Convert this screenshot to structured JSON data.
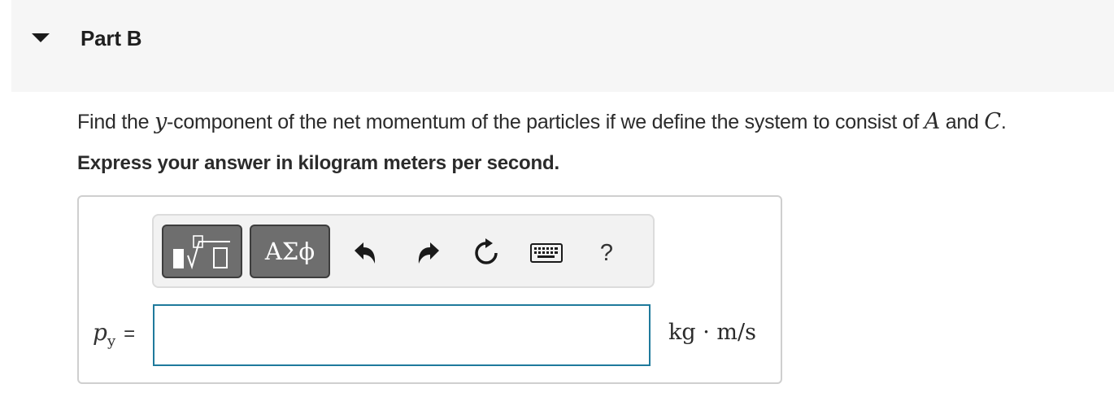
{
  "part": {
    "title": "Part B",
    "toggle_icon": "caret-down-icon"
  },
  "question": {
    "text_before": "Find the ",
    "var_y": "y",
    "text_middle": "-component of the net momentum of the particles if we define the system to consist of ",
    "var_a": "A",
    "text_and": " and ",
    "var_c": "C",
    "text_end": "."
  },
  "instruction": "Express your answer in kilogram meters per second.",
  "toolbar": {
    "templates_icon": "templates-icon",
    "greek_label": "ΑΣϕ",
    "undo_icon": "undo-icon",
    "redo_icon": "redo-icon",
    "reset_icon": "reset-icon",
    "keyboard_icon": "keyboard-icon",
    "help_label": "?"
  },
  "answer": {
    "variable": "p",
    "subscript": "y",
    "equals": "=",
    "value": "",
    "units": "kg · m/s"
  },
  "colors": {
    "header_bg": "#f6f6f6",
    "input_border": "#1f7a9c",
    "button_dark": "#6e6e6e"
  }
}
